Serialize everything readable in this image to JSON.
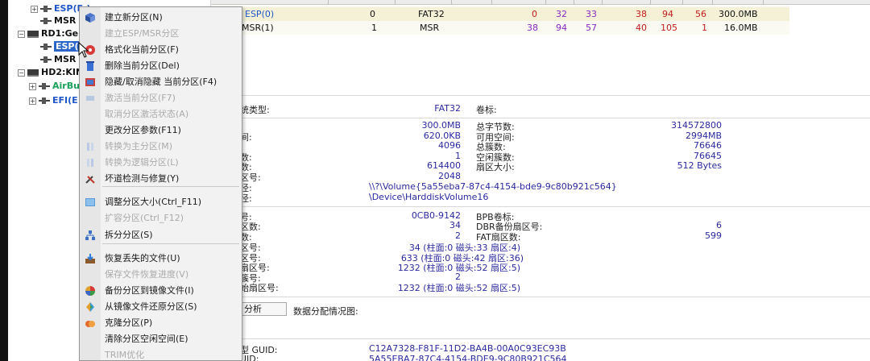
{
  "tree": {
    "items": [
      {
        "label": "ESP(E:)",
        "color": "#1e56c8"
      },
      {
        "label": "MSR",
        "color": "#111111"
      },
      {
        "label": "RD1:Ge",
        "color": "#111111"
      },
      {
        "label": "ESP(",
        "color": "#ffffff"
      },
      {
        "label": "MSR",
        "color": "#111111"
      },
      {
        "label": "HD2:KIN",
        "color": "#111111"
      },
      {
        "label": "AirBu",
        "color": "#1aa05a"
      },
      {
        "label": "EFI(E",
        "color": "#1e56c8"
      }
    ]
  },
  "partitions": [
    {
      "name": "ESP(0)",
      "index": "0",
      "fs": "FAT32",
      "c1": "0",
      "h1": "32",
      "s1": "33",
      "c2": "38",
      "h2": "94",
      "s2": "56",
      "size": "300.0MB"
    },
    {
      "name": "MSR(1)",
      "index": "1",
      "fs": "MSR",
      "c1": "38",
      "h1": "94",
      "s1": "57",
      "c2": "40",
      "h2": "105",
      "s2": "1",
      "size": "16.0MB"
    }
  ],
  "context_menu": {
    "items": [
      {
        "label": "建立新分区(N)",
        "icon": "new-partition-icon",
        "enabled": true
      },
      {
        "label": "建立ESP/MSR分区",
        "icon": "",
        "enabled": false
      },
      {
        "label": "格式化当前分区(F)",
        "icon": "format-icon",
        "enabled": true
      },
      {
        "label": "删除当前分区(Del)",
        "icon": "delete-icon",
        "enabled": true
      },
      {
        "label": "隐藏/取消隐藏 当前分区(F4)",
        "icon": "hide-icon",
        "enabled": true
      },
      {
        "label": "激活当前分区(F7)",
        "icon": "activate-icon",
        "enabled": false
      },
      {
        "label": "取消分区激活状态(A)",
        "icon": "",
        "enabled": false
      },
      {
        "label": "更改分区参数(F11)",
        "icon": "",
        "enabled": true
      },
      {
        "label": "转换为主分区(M)",
        "icon": "convert-primary-icon",
        "enabled": false
      },
      {
        "label": "转换为逻辑分区(L)",
        "icon": "convert-logical-icon",
        "enabled": false
      },
      {
        "label": "坏道检测与修复(Y)",
        "icon": "tools-icon",
        "enabled": true
      },
      {
        "label": "调整分区大小(Ctrl_F11)",
        "icon": "resize-icon",
        "enabled": true
      },
      {
        "label": "扩容分区(Ctrl_F12)",
        "icon": "",
        "enabled": false
      },
      {
        "label": "拆分分区(S)",
        "icon": "split-icon",
        "enabled": true
      },
      {
        "label": "恢复丢失的文件(U)",
        "icon": "recover-icon",
        "enabled": true
      },
      {
        "label": "保存文件恢复进度(V)",
        "icon": "",
        "enabled": false
      },
      {
        "label": "备份分区到镜像文件(I)",
        "icon": "backup-icon",
        "enabled": true
      },
      {
        "label": "从镜像文件还原分区(S)",
        "icon": "restore-icon",
        "enabled": true
      },
      {
        "label": "克隆分区(P)",
        "icon": "clone-icon",
        "enabled": true
      },
      {
        "label": "清除分区空闲空间(E)",
        "icon": "",
        "enabled": true
      },
      {
        "label": "TRIM优化",
        "icon": "",
        "enabled": false
      }
    ]
  },
  "details": {
    "fs_type_label": "统类型:",
    "fs_type_value": "FAT32",
    "volume_label_label": "卷标:",
    "left_labels": [
      "间:",
      "数:",
      "数:",
      "区号:",
      "径:",
      "径:"
    ],
    "left_values": [
      "300.0MB",
      "620.0KB",
      "4096",
      "1",
      "614400",
      "2048"
    ],
    "path1": "\\\\?\\Volume{5a55eba7-87c4-4154-bde9-9c80b921c564}",
    "path2": "\\Device\\HarddiskVolume16",
    "right_labels": [
      "总字节数:",
      "可用空间:",
      "总簇数:",
      "空闲簇数:",
      "扇区大小:"
    ],
    "right_values": [
      "314572800",
      "2994MB",
      "76646",
      "76645",
      "512 Bytes"
    ],
    "sec2_left_labels": [
      "号:",
      "区数:",
      "数:",
      "区号:",
      "区号:",
      "扇区号:",
      "簇号:",
      "始扇区号:"
    ],
    "sec2_values": [
      "0CB0-9142",
      "34",
      "2",
      "34 (柱面:0 磁头:33 扇区:4)",
      "633 (柱面:0 磁头:42 扇区:36)",
      "1232 (柱面:0 磁头:52 扇区:5)",
      "2",
      "1232 (柱面:0 磁头:52 扇区:5)"
    ],
    "sec2_right_labels": [
      "BPB卷标:",
      "DBR备份扇区号:",
      "FAT扇区数:"
    ],
    "sec2_right_values": [
      "",
      "6",
      "599"
    ],
    "analyze_button": "分析",
    "data_alloc_label": "数据分配情况图:",
    "guid_type_label": "型 GUID:",
    "guid_type_value": "C12A7328-F81F-11D2-BA4B-00A0C93EC93B",
    "guid_label": "UID:",
    "guid_value": "5A55EBA7-87C4-4154-BDE9-9C80B921C564"
  }
}
